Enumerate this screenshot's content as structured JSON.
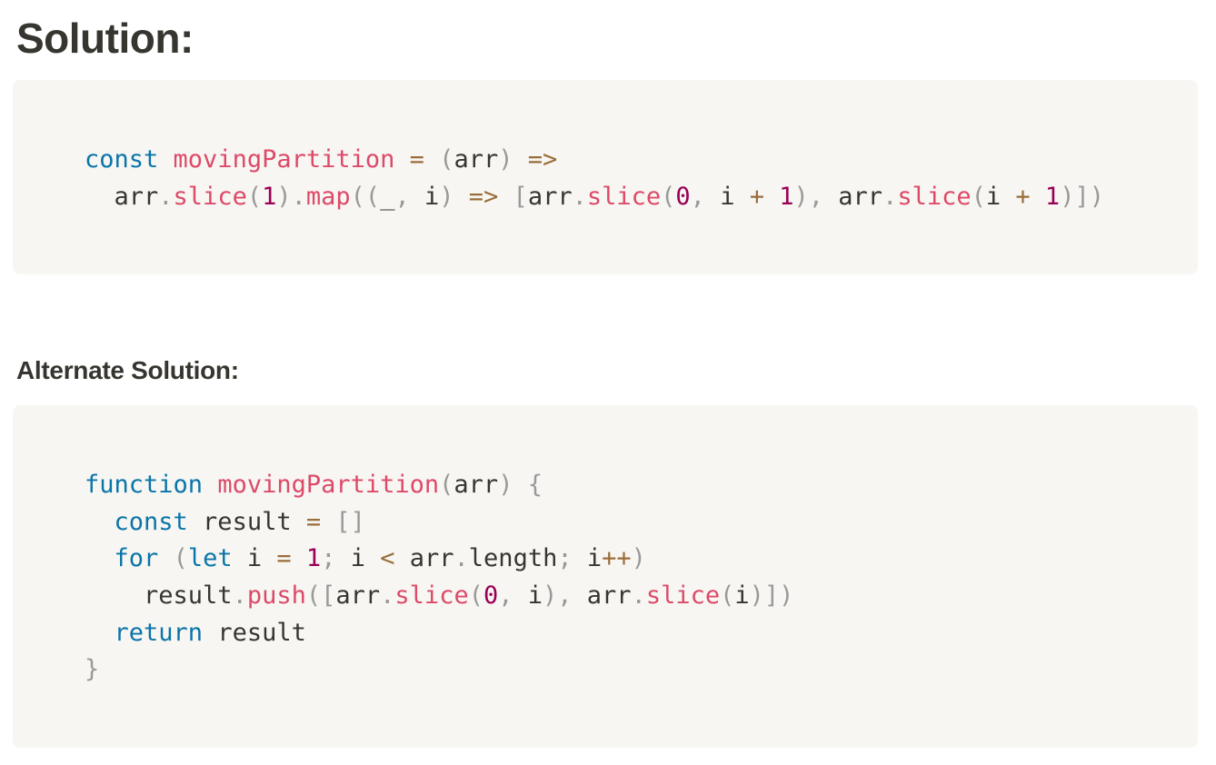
{
  "headings": {
    "solution": "Solution:",
    "alternate": "Alternate Solution:"
  },
  "colors": {
    "keyword": "#0b75a8",
    "function": "#dd4a68",
    "operator": "#9a6e3a",
    "number": "#990055",
    "punctuation": "#999999",
    "text": "#37352f",
    "code_background": "#f7f6f3"
  },
  "code_blocks": [
    {
      "lines": [
        [
          [
            "kw",
            "const"
          ],
          [
            "tx",
            " "
          ],
          [
            "fn",
            "movingPartition"
          ],
          [
            "tx",
            " "
          ],
          [
            "op",
            "="
          ],
          [
            "tx",
            " "
          ],
          [
            "pn",
            "("
          ],
          [
            "tx",
            "arr"
          ],
          [
            "pn",
            ")"
          ],
          [
            "tx",
            " "
          ],
          [
            "op",
            "=>"
          ]
        ],
        [
          [
            "tx",
            "  arr"
          ],
          [
            "pn",
            "."
          ],
          [
            "fn",
            "slice"
          ],
          [
            "pn",
            "("
          ],
          [
            "num",
            "1"
          ],
          [
            "pn",
            ")"
          ],
          [
            "pn",
            "."
          ],
          [
            "fn",
            "map"
          ],
          [
            "pn",
            "(("
          ],
          [
            "tx",
            "_"
          ],
          [
            "pn",
            ","
          ],
          [
            "tx",
            " i"
          ],
          [
            "pn",
            ")"
          ],
          [
            "tx",
            " "
          ],
          [
            "op",
            "=>"
          ],
          [
            "tx",
            " "
          ],
          [
            "pn",
            "["
          ],
          [
            "tx",
            "arr"
          ],
          [
            "pn",
            "."
          ],
          [
            "fn",
            "slice"
          ],
          [
            "pn",
            "("
          ],
          [
            "num",
            "0"
          ],
          [
            "pn",
            ","
          ],
          [
            "tx",
            " i "
          ],
          [
            "op",
            "+"
          ],
          [
            "tx",
            " "
          ],
          [
            "num",
            "1"
          ],
          [
            "pn",
            "),"
          ],
          [
            "tx",
            " arr"
          ],
          [
            "pn",
            "."
          ],
          [
            "fn",
            "slice"
          ],
          [
            "pn",
            "("
          ],
          [
            "tx",
            "i "
          ],
          [
            "op",
            "+"
          ],
          [
            "tx",
            " "
          ],
          [
            "num",
            "1"
          ],
          [
            "pn",
            ")])"
          ]
        ]
      ]
    },
    {
      "lines": [
        [
          [
            "kw",
            "function"
          ],
          [
            "tx",
            " "
          ],
          [
            "fn",
            "movingPartition"
          ],
          [
            "pn",
            "("
          ],
          [
            "tx",
            "arr"
          ],
          [
            "pn",
            ")"
          ],
          [
            "tx",
            " "
          ],
          [
            "pn",
            "{"
          ]
        ],
        [
          [
            "tx",
            "  "
          ],
          [
            "kw",
            "const"
          ],
          [
            "tx",
            " result "
          ],
          [
            "op",
            "="
          ],
          [
            "tx",
            " "
          ],
          [
            "pn",
            "[]"
          ]
        ],
        [
          [
            "tx",
            "  "
          ],
          [
            "kw",
            "for"
          ],
          [
            "tx",
            " "
          ],
          [
            "pn",
            "("
          ],
          [
            "kw",
            "let"
          ],
          [
            "tx",
            " i "
          ],
          [
            "op",
            "="
          ],
          [
            "tx",
            " "
          ],
          [
            "num",
            "1"
          ],
          [
            "pn",
            ";"
          ],
          [
            "tx",
            " i "
          ],
          [
            "op",
            "<"
          ],
          [
            "tx",
            " arr"
          ],
          [
            "pn",
            "."
          ],
          [
            "tx",
            "length"
          ],
          [
            "pn",
            ";"
          ],
          [
            "tx",
            " i"
          ],
          [
            "op",
            "++"
          ],
          [
            "pn",
            ")"
          ]
        ],
        [
          [
            "tx",
            "    result"
          ],
          [
            "pn",
            "."
          ],
          [
            "fn",
            "push"
          ],
          [
            "pn",
            "(["
          ],
          [
            "tx",
            "arr"
          ],
          [
            "pn",
            "."
          ],
          [
            "fn",
            "slice"
          ],
          [
            "pn",
            "("
          ],
          [
            "num",
            "0"
          ],
          [
            "pn",
            ","
          ],
          [
            "tx",
            " i"
          ],
          [
            "pn",
            "),"
          ],
          [
            "tx",
            " arr"
          ],
          [
            "pn",
            "."
          ],
          [
            "fn",
            "slice"
          ],
          [
            "pn",
            "("
          ],
          [
            "tx",
            "i"
          ],
          [
            "pn",
            ")])"
          ]
        ],
        [
          [
            "tx",
            "  "
          ],
          [
            "kw",
            "return"
          ],
          [
            "tx",
            " result"
          ]
        ],
        [
          [
            "pn",
            "}"
          ]
        ]
      ]
    }
  ]
}
